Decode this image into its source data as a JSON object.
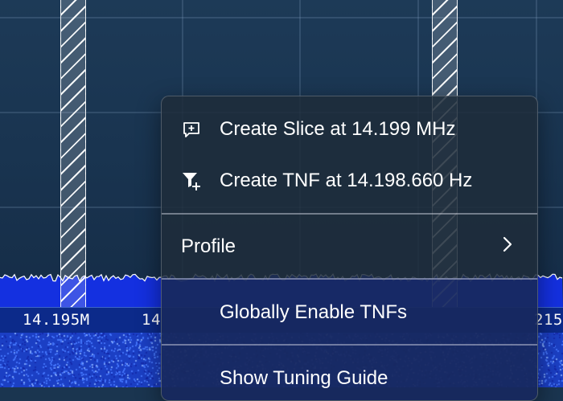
{
  "panadapter": {
    "frequency_labels": [
      {
        "text": "14.195M"
      },
      {
        "text": "14"
      },
      {
        "text": "215"
      }
    ],
    "colors": {
      "spectrum_fill": "#1430e0",
      "trace": "#ffffff",
      "waterfall": "#1b3fc4",
      "scale_bar": "#0c2a8a"
    }
  },
  "context_menu": {
    "items": [
      {
        "label": "Create Slice at 14.199 MHz",
        "icon": "add-slice-icon"
      },
      {
        "label": "Create TNF at 14.198.660 Hz",
        "icon": "filter-plus-icon"
      },
      {
        "label": "Profile",
        "icon": "chevron-right-icon"
      },
      {
        "label": "Globally Enable TNFs"
      },
      {
        "label": "Show Tuning Guide"
      }
    ]
  }
}
